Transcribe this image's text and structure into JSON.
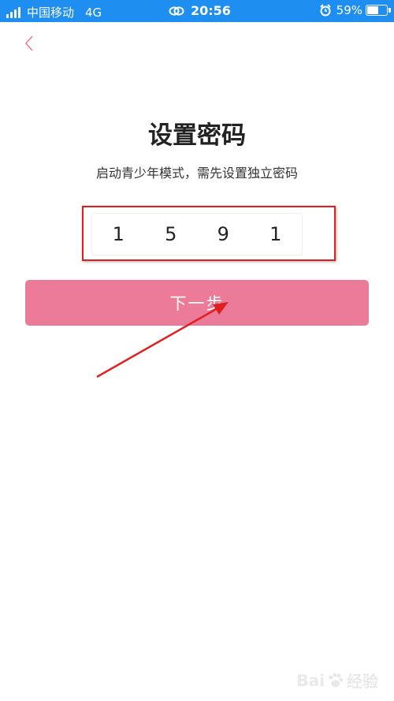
{
  "status_bar": {
    "carrier": "中国移动",
    "network": "4G",
    "time": "20:56",
    "battery_text": "59%",
    "battery_level": 0.59
  },
  "page": {
    "title": "设置密码",
    "subtitle": "启动青少年模式，需先设置独立密码",
    "code_digits": [
      "1",
      "5",
      "9",
      "1"
    ],
    "next_label": "下一步"
  },
  "watermark": {
    "prefix": "Bai",
    "suffix": "经验"
  },
  "colors": {
    "status_bar": "#1e8ef0",
    "accent": "#eb7b99",
    "annotation_red": "#e02020"
  },
  "icons": {
    "back": "chevron-left-icon",
    "link": "link-icon",
    "alarm": "alarm-icon",
    "battery": "battery-icon",
    "signal": "signal-icon"
  }
}
